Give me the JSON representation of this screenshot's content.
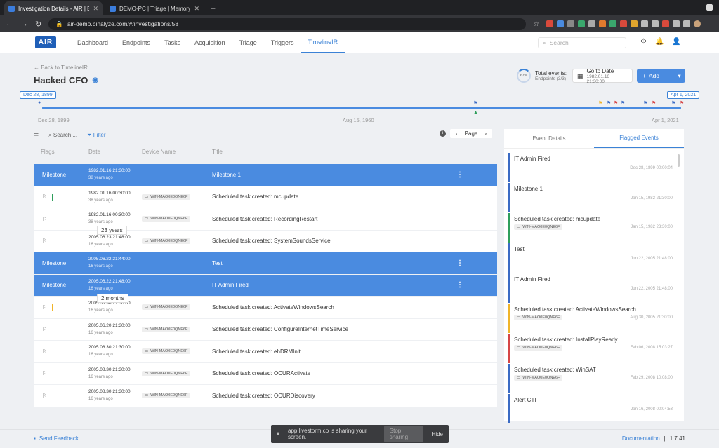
{
  "browser": {
    "tabs": [
      {
        "title": "Investigation Details - AIR | Bi...",
        "active": true
      },
      {
        "title": "DEMO-PC | Triage | Memory I...",
        "active": false
      }
    ],
    "url": "air-demo.binalyze.com/#/investigations/58"
  },
  "app": {
    "logo": "AIR",
    "nav": [
      "Dashboard",
      "Endpoints",
      "Tasks",
      "Acquisition",
      "Triage",
      "Triggers",
      "TimelineIR"
    ],
    "active_nav": "TimelineIR",
    "search_placeholder": "Search"
  },
  "page": {
    "back_label": "← Back to TimelineIR",
    "title": "Hacked CFO",
    "progress_pct": "67%",
    "total_events_label": "Total events:",
    "endpoints_label": "Endpoints (3/3)",
    "goto_label": "Go to Date",
    "goto_value": "1982.01.16 21:30:00",
    "add_label": "Add"
  },
  "timeline": {
    "start_bubble": "Dec 28, 1899",
    "end_bubble": "Apr 1, 2021",
    "start_label": "Dec 28, 1899",
    "mid_label": "Aug 15, 1960",
    "end_label": "Apr 1, 2021"
  },
  "table": {
    "search_placeholder": "Search ...",
    "filter_label": "Filter",
    "page_label": "Page",
    "headers": {
      "flags": "Flags",
      "date": "Date",
      "device": "Device Name",
      "title": "Title"
    },
    "rows": [
      {
        "type": "milestone",
        "label": "Milestone",
        "date": "1982.01.16 21:30:00",
        "ago": "38 years ago",
        "device": "",
        "title": "Milestone 1",
        "stripe": ""
      },
      {
        "type": "event",
        "label": "",
        "date": "1982.01.16 00:30:00",
        "ago": "38 years ago",
        "device": "WIN-MAO0E0QNE6F",
        "title": "Scheduled task created: mcupdate",
        "stripe": "#2e9e5b"
      },
      {
        "type": "event",
        "label": "",
        "date": "1982.01.16 00:30:00",
        "ago": "38 years ago",
        "device": "WIN-MAO0E0QNE6F",
        "title": "Scheduled task created: RecordingRestart",
        "stripe": ""
      },
      {
        "type": "event",
        "label": "",
        "date": "2005.06.23 21:48:00",
        "ago": "16 years ago",
        "device": "WIN-MAO0E0QNE6F",
        "title": "Scheduled task created: SystemSoundsService",
        "stripe": ""
      },
      {
        "type": "milestone",
        "label": "Milestone",
        "date": "2005.06.22 21:44:00",
        "ago": "16 years ago",
        "device": "",
        "title": "Test",
        "stripe": ""
      },
      {
        "type": "milestone",
        "label": "Milestone",
        "date": "2005.06.22 21:48:00",
        "ago": "16 years ago",
        "device": "",
        "title": "IT Admin Fired",
        "stripe": ""
      },
      {
        "type": "event",
        "label": "",
        "date": "2005.08.30 21:30:00",
        "ago": "16 years ago",
        "device": "WIN-MAO0E0QNE6F",
        "title": "Scheduled task created: ActivateWindowsSearch",
        "stripe": "#f0b429"
      },
      {
        "type": "event",
        "label": "",
        "date": "2005.06.20 21:30:00",
        "ago": "16 years ago",
        "device": "WIN-MAO0E0QNE6F",
        "title": "Scheduled task created: ConfigureInternetTimeService",
        "stripe": ""
      },
      {
        "type": "event",
        "label": "",
        "date": "2005.08.30 21:30:00",
        "ago": "16 years ago",
        "device": "WIN-MAO0E0QNE6F",
        "title": "Scheduled task created: ehDRMInit",
        "stripe": ""
      },
      {
        "type": "event",
        "label": "",
        "date": "2005.08.30 21:30:00",
        "ago": "16 years ago",
        "device": "WIN-MAO0E0QNE6F",
        "title": "Scheduled task created: OCURActivate",
        "stripe": ""
      },
      {
        "type": "event",
        "label": "",
        "date": "2005.08.30 21:30:00",
        "ago": "16 years ago",
        "device": "WIN-MAO0E0QNE6F",
        "title": "Scheduled task created: OCURDiscovery",
        "stripe": ""
      }
    ],
    "tooltip_23": "23 years",
    "tooltip_2m": "2 months"
  },
  "panel": {
    "tabs": [
      "Event Details",
      "Flagged Events"
    ],
    "active_tab": "Flagged Events",
    "items": [
      {
        "title": "IT Admin Fired",
        "device": "",
        "date": "Dec 28, 1899 00:00:04",
        "color": "#3b6bc4"
      },
      {
        "title": "Milestone 1",
        "device": "",
        "date": "Jan 15, 1982 21:30:00",
        "color": "#3b6bc4"
      },
      {
        "title": "Scheduled task created: mcupdate",
        "device": "WIN-MAO0E0QNE6F",
        "date": "Jan 15, 1982 23:30:00",
        "color": "#2e9e5b"
      },
      {
        "title": "Test",
        "device": "",
        "date": "Jun 22, 2005 21:48:00",
        "color": "#3b6bc4"
      },
      {
        "title": "IT Admin Fired",
        "device": "",
        "date": "Jun 22, 2005 21:48:00",
        "color": "#3b6bc4"
      },
      {
        "title": "Scheduled task created: ActivateWindowsSearch",
        "device": "WIN-MAO0E0QNE6F",
        "date": "Aug 30, 2005 21:30:00",
        "color": "#f0b429"
      },
      {
        "title": "Scheduled task created: InstallPlayReady",
        "device": "WIN-MAO0E0QNE6F",
        "date": "Feb 06, 2008 15:03:27",
        "color": "#d64545"
      },
      {
        "title": "Scheduled task created: WinSAT",
        "device": "WIN-MAO0E0QNE6F",
        "date": "Feb 29, 2008 10:08:00",
        "color": "#3b6bc4"
      },
      {
        "title": "Alert CTI",
        "device": "",
        "date": "Jan 16, 2008 00:04:53",
        "color": "#3b6bc4"
      }
    ]
  },
  "footer": {
    "feedback": "Send Feedback",
    "documentation": "Documentation",
    "version": "1.7.41"
  },
  "share_bar": {
    "text": "app.livestorm.co is sharing your screen.",
    "stop": "Stop sharing",
    "hide": "Hide"
  },
  "colors": {
    "accent": "#4a8be0",
    "milestone": "#4a8be0"
  }
}
